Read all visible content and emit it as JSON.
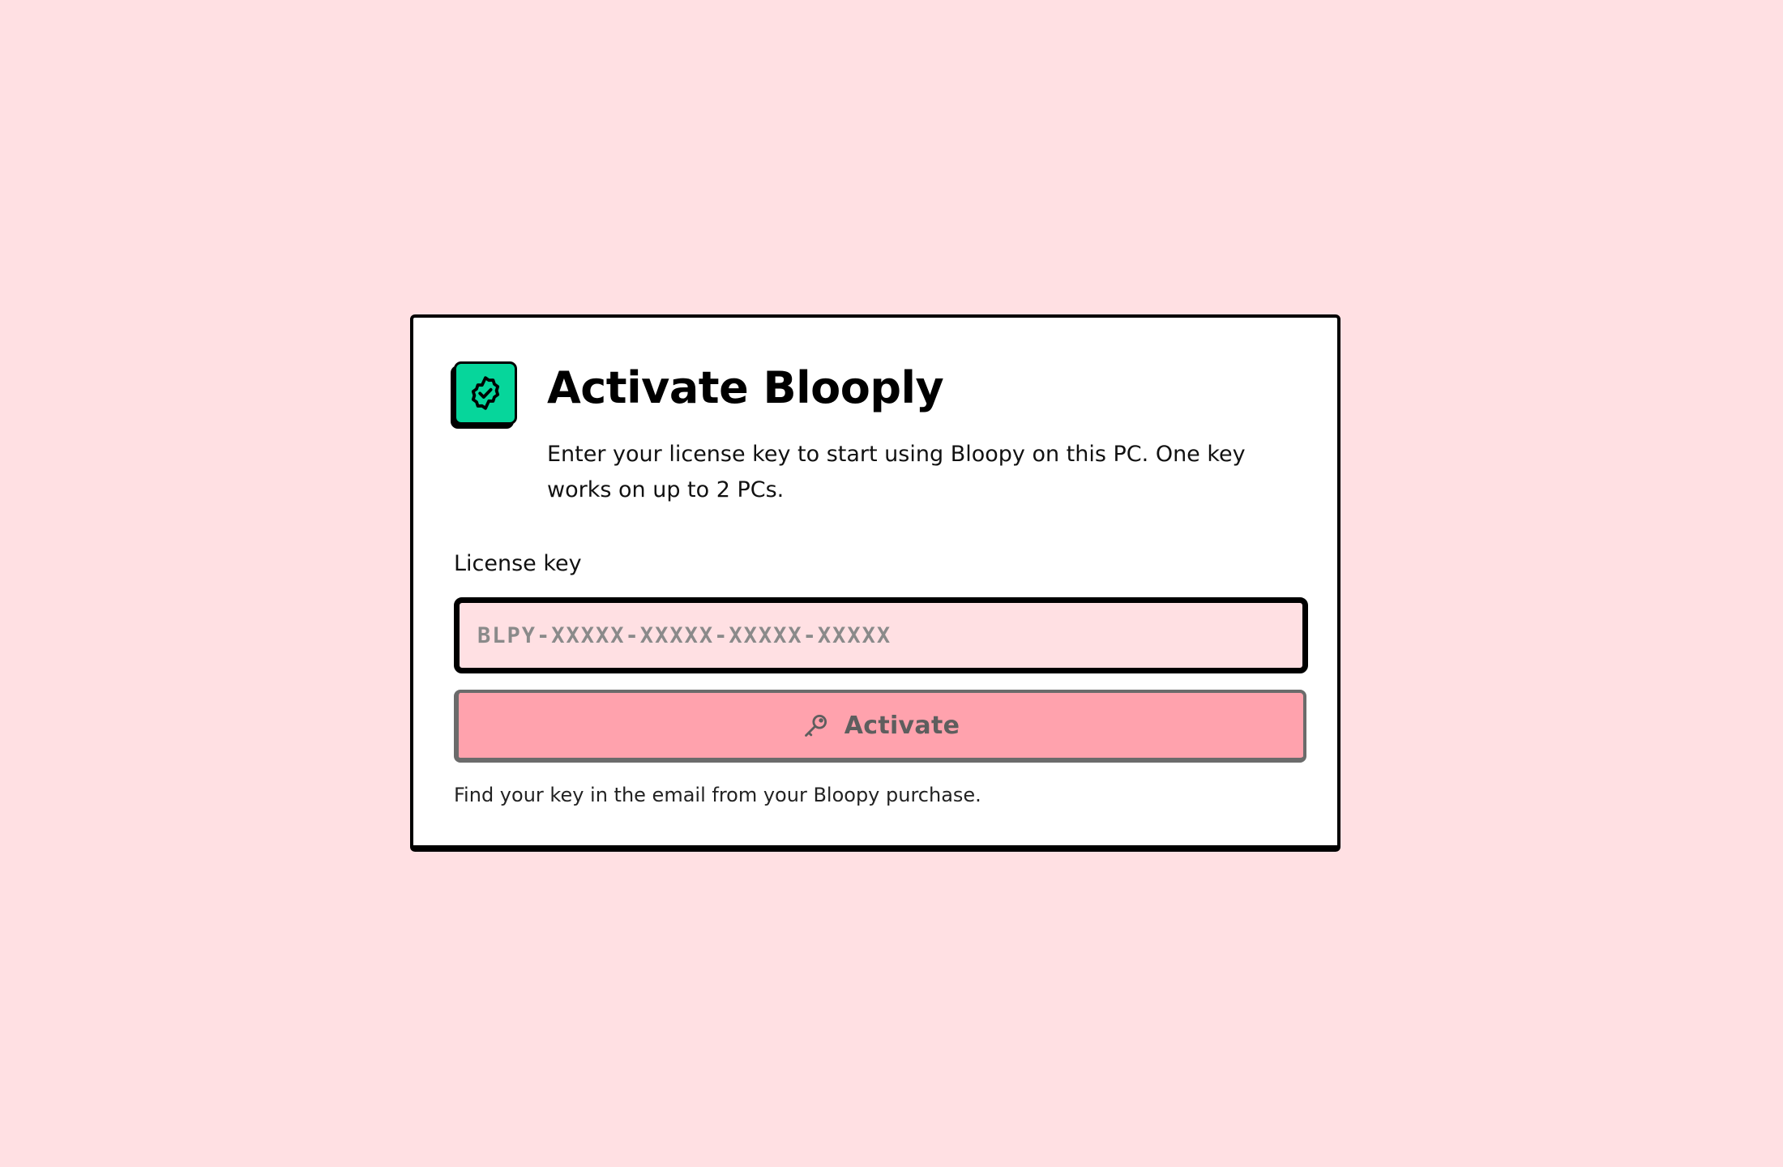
{
  "colors": {
    "background": "#FFE0E3",
    "card": "#FFFFFF",
    "badge": "#06D69B",
    "button": "#FFA2AD",
    "input": "#FFE0E3"
  },
  "dialog": {
    "badge_icon": "verified-badge-icon",
    "title": "Activate Blooply",
    "description": "Enter your license key to start using Bloopy on this PC. One key works on up to 2 PCs.",
    "license_label": "License key",
    "license_input": {
      "value": "",
      "placeholder": "BLPY-XXXXX-XXXXX-XXXXX-XXXXX"
    },
    "activate_button": {
      "icon": "key-icon",
      "label": "Activate"
    },
    "hint": "Find your key in the email from your Bloopy purchase."
  }
}
